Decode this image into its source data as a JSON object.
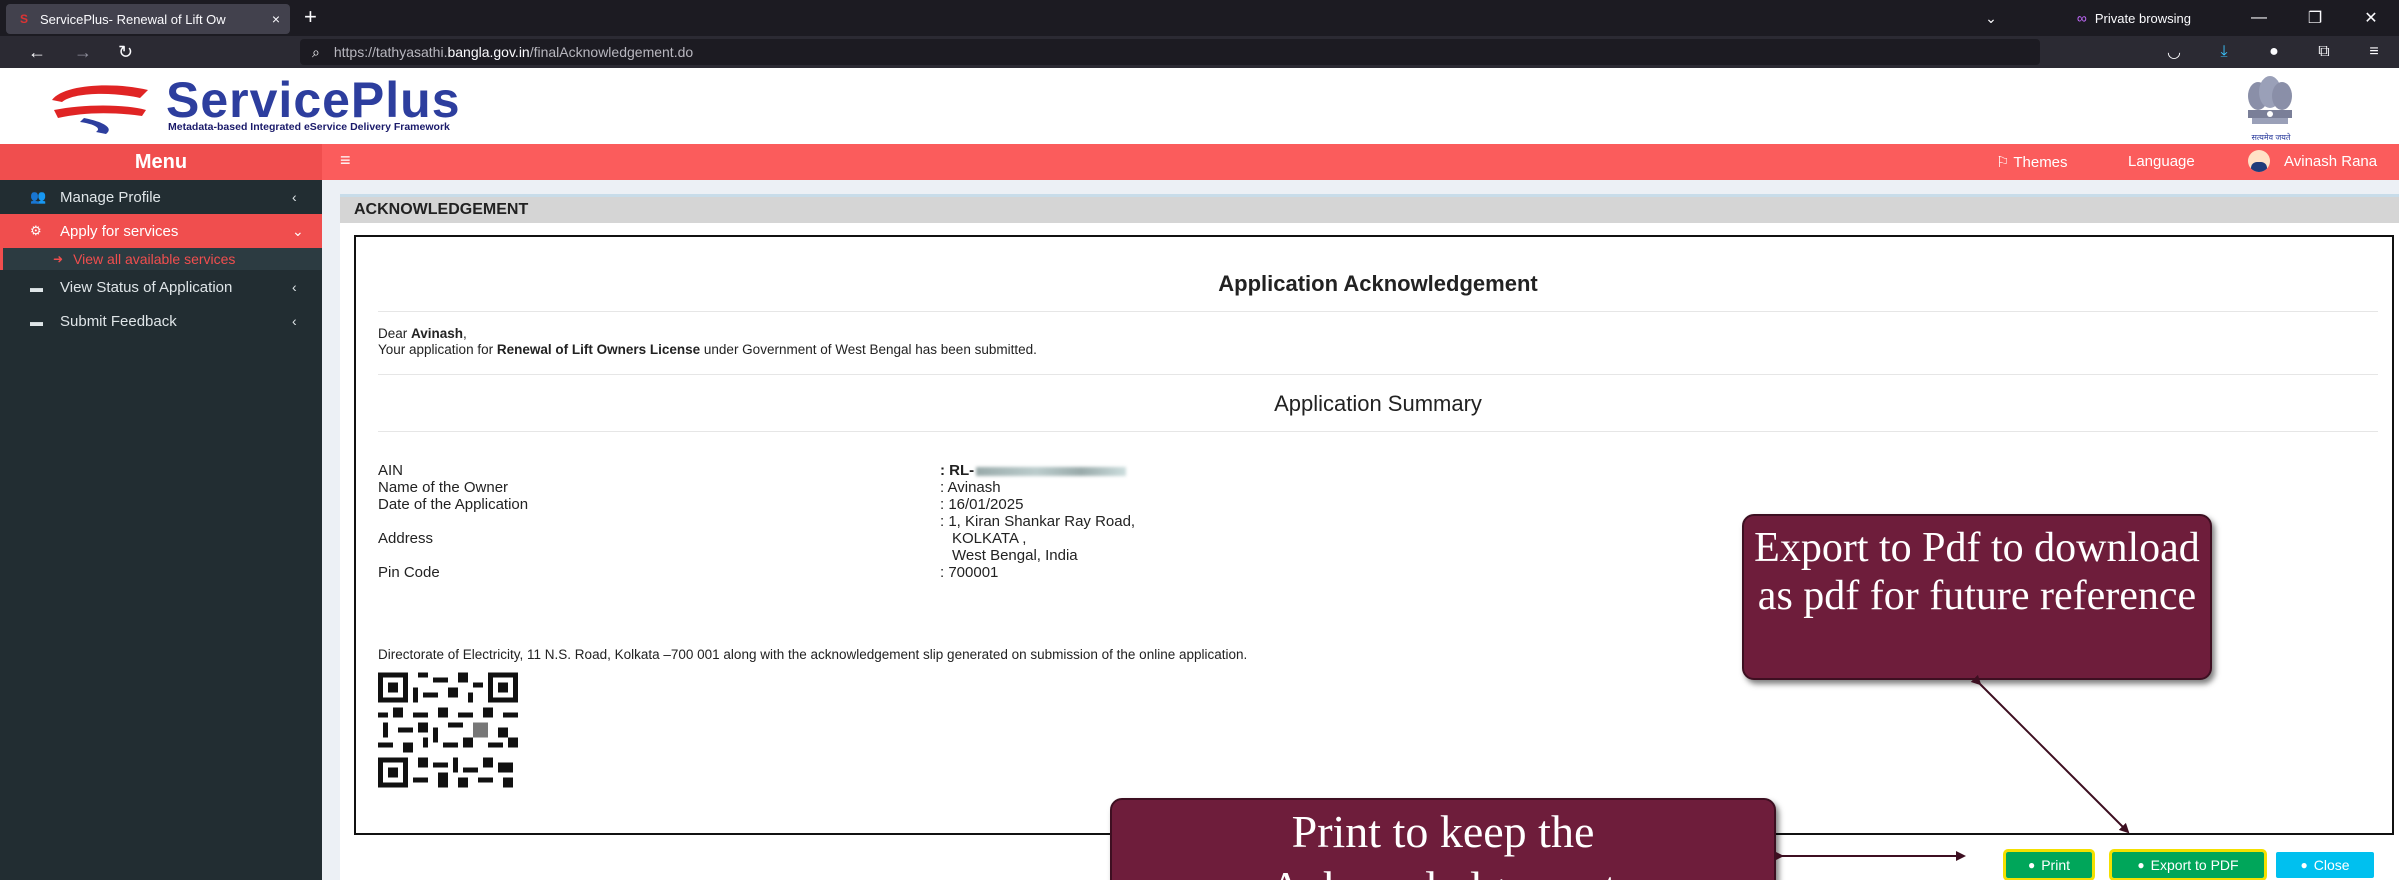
{
  "browser": {
    "tab_title": "ServicePlus- Renewal of Lift Ow",
    "tab_close": "×",
    "new_tab": "+",
    "private_label": "Private browsing",
    "url_prefix": "https://tathyasathi.",
    "url_domain": "bangla.gov.in",
    "url_path": "/finalAcknowledgement.do"
  },
  "site": {
    "logo_text": "ServicePlus",
    "logo_subtitle": "Metadata-based Integrated eService Delivery Framework",
    "emblem_caption": "सत्यमेव जयते"
  },
  "appbar": {
    "menu_label": "Menu",
    "themes_label": "Themes",
    "language_label": "Language",
    "user_name": "Avinash Rana"
  },
  "sidebar": {
    "items": [
      {
        "label": "Manage Profile",
        "icon": "users-icon"
      },
      {
        "label": "Apply for services",
        "icon": "cogs-icon"
      },
      {
        "label": "View Status of Application",
        "icon": "card-icon"
      },
      {
        "label": "Submit Feedback",
        "icon": "card-icon"
      }
    ],
    "subitem": "View all available services"
  },
  "panel": {
    "title": "ACKNOWLEDGEMENT",
    "ack_title": "Application Acknowledgement",
    "dear": "Dear ",
    "dear_name": "Avinash",
    "dear_comma": ",",
    "msg_pre": "Your application for ",
    "msg_service": "Renewal of Lift Owners License",
    "msg_post": " under Government of West Bengal has been submitted.",
    "summary_title": "Application Summary",
    "rows": [
      {
        "key": "AIN",
        "value": ": RL-"
      },
      {
        "key": "Name of the Owner",
        "value": ": Avinash"
      },
      {
        "key": "Date of the Application",
        "value": ": 16/01/2025"
      },
      {
        "key": "",
        "value": ": 1, Kiran Shankar Ray Road,"
      },
      {
        "key": "Address",
        "value": "KOLKATA ,"
      },
      {
        "key": "",
        "value": "West Bengal, India"
      },
      {
        "key": "Pin Code",
        "value": ": 700001"
      }
    ],
    "footnote": "Directorate of Electricity, 11 N.S. Road, Kolkata –700 001 along with the acknowledgement slip generated on submission of the online application."
  },
  "buttons": {
    "print": "Print",
    "export": "Export to PDF",
    "close": "Close"
  },
  "callouts": {
    "pdf_text": "Export to Pdf to download as pdf for future reference",
    "print_line1": "Print to keep the",
    "print_line2": "Acknowledgement"
  },
  "colors": {
    "brand_red": "#fb5c5c",
    "sidebar_bg": "#222d32",
    "button_green": "#00a65a",
    "button_cyan": "#00c0ef",
    "callout_bg": "#6e1d3b"
  }
}
